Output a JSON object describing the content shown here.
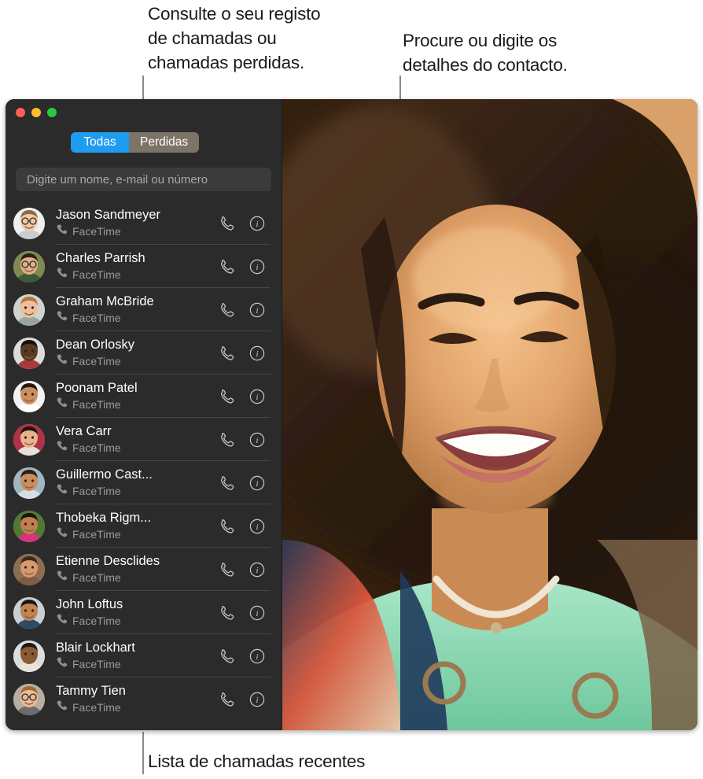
{
  "annotations": {
    "left": "Consulte o seu registo\nde chamadas ou\nchamadas perdidas.",
    "right": "Procure ou digite os\ndetalhes do contacto.",
    "bottom": "Lista de chamadas recentes"
  },
  "window": {
    "traffic_lights": {
      "close_label": "close-button",
      "minimize_label": "minimize-button",
      "maximize_label": "maximize-button",
      "close_color": "#ff5f57",
      "minimize_color": "#febc2e",
      "maximize_color": "#28c840"
    },
    "segmented_control": {
      "selected": "Todas",
      "options": [
        "Todas",
        "Perdidas"
      ],
      "active_color": "#1e9cf0",
      "inactive_color": "#7d7468"
    },
    "search": {
      "value": "",
      "placeholder": "Digite um nome, e-mail ou número"
    },
    "background_color": "#2b2b2b"
  },
  "contacts": [
    {
      "name": "Jason Sandmeyer",
      "service": "FaceTime",
      "skin": "#f0c9a8",
      "hair": "#8d6a44",
      "shirt": "#c9cdd2",
      "bg": "#efefef",
      "glasses": true
    },
    {
      "name": "Charles Parrish",
      "service": "FaceTime",
      "skin": "#e0b089",
      "hair": "#2c2218",
      "shirt": "#3c5a3a",
      "bg": "#7d8a52",
      "glasses": true
    },
    {
      "name": "Graham McBride",
      "service": "FaceTime",
      "skin": "#edbf9a",
      "hair": "#b0753a",
      "shirt": "#97a5a3",
      "bg": "#cfd3cd",
      "glasses": false
    },
    {
      "name": "Dean Orlosky",
      "service": "FaceTime",
      "skin": "#5a3a22",
      "hair": "#17110c",
      "shirt": "#a83a3a",
      "bg": "#dcdcdc",
      "glasses": false
    },
    {
      "name": "Poonam Patel",
      "service": "FaceTime",
      "skin": "#c98f5f",
      "hair": "#241a12",
      "shirt": "#ffffff",
      "bg": "#f2f2f2",
      "glasses": false
    },
    {
      "name": "Vera Carr",
      "service": "FaceTime",
      "skin": "#e8b38c",
      "hair": "#1d1410",
      "shirt": "#e6e1d8",
      "bg": "#b03246",
      "glasses": false
    },
    {
      "name": "Guillermo Cast...",
      "service": "FaceTime",
      "skin": "#c98d5c",
      "hair": "#2a2018",
      "shirt": "#d8dde1",
      "bg": "#9fb6c4",
      "glasses": false
    },
    {
      "name": "Thobeka Rigm...",
      "service": "FaceTime",
      "skin": "#c07f4e",
      "hair": "#1c1410",
      "shirt": "#d8337f",
      "bg": "#4e7a33",
      "glasses": false
    },
    {
      "name": "Etienne Desclides",
      "service": "FaceTime",
      "skin": "#d79a6d",
      "hair": "#3a2a1c",
      "shirt": "#7c5c44",
      "bg": "#8d6d52",
      "glasses": false
    },
    {
      "name": "John Loftus",
      "service": "FaceTime",
      "skin": "#c08450",
      "hair": "#1b1410",
      "shirt": "#2c4a6a",
      "bg": "#c8cfd6",
      "glasses": false
    },
    {
      "name": "Blair Lockhart",
      "service": "FaceTime",
      "skin": "#8a5a33",
      "hair": "#201812",
      "shirt": "#e8e4da",
      "bg": "#dddddd",
      "glasses": false
    },
    {
      "name": "Tammy Tien",
      "service": "FaceTime",
      "skin": "#e8bd93",
      "hair": "#a06a3c",
      "shirt": "#6b6b70",
      "bg": "#b8ada0",
      "glasses": true
    }
  ],
  "icons": {
    "phone": "phone-handset-icon",
    "info": "info-circle-icon",
    "facetime": "facetime-handset-icon"
  }
}
